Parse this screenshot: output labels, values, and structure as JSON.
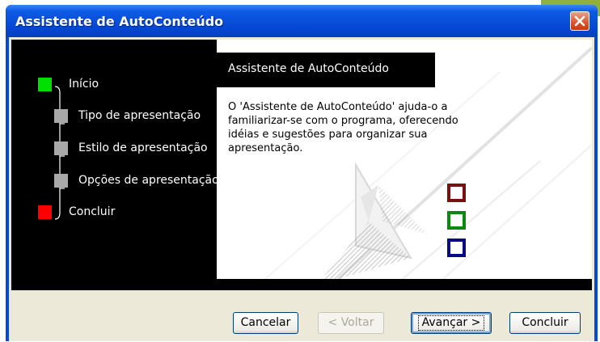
{
  "window": {
    "title": "Assistente de AutoConteúdo"
  },
  "steps": [
    {
      "label": "Início",
      "state": "current",
      "color": "#00e000"
    },
    {
      "label": "Tipo de apresentação",
      "state": "pending",
      "color": "#a9a9a9"
    },
    {
      "label": "Estilo de apresentação",
      "state": "pending",
      "color": "#a9a9a9"
    },
    {
      "label": "Opções de apresentação",
      "state": "pending",
      "color": "#a9a9a9"
    },
    {
      "label": "Concluir",
      "state": "final",
      "color": "#ff0000"
    }
  ],
  "panel": {
    "title": "Assistente de AutoConteúdo",
    "description": "O 'Assistente de AutoConteúdo' ajuda-o a familiarizar-se com o programa, oferecendo idéias e sugestões para organizar sua apresentação."
  },
  "decor_squares": [
    "#7a1010",
    "#0a8a0a",
    "#0a0a80"
  ],
  "buttons": {
    "cancel": "Cancelar",
    "back": "< Voltar",
    "next": "Avançar >",
    "finish": "Concluir"
  },
  "colors": {
    "titlebar": "#0546d2",
    "close": "#d9542b"
  }
}
